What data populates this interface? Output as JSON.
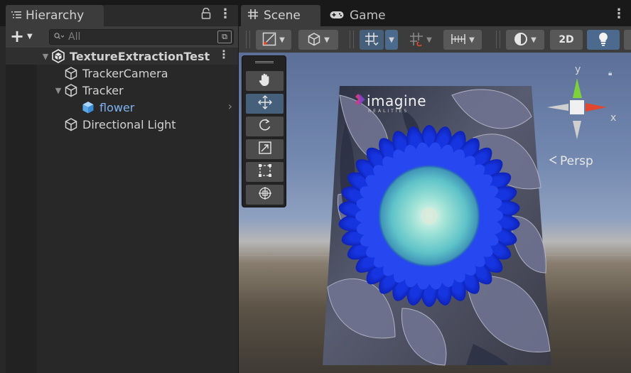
{
  "hierarchy": {
    "tab_label": "Hierarchy",
    "tab_icon": "hierarchy-list-icon",
    "search_placeholder": "All",
    "items": [
      {
        "label": "TextureExtractionTest",
        "icon": "unity-scene-icon",
        "type": "scene"
      },
      {
        "label": "TrackerCamera",
        "icon": "gameobject-cube-outline-icon"
      },
      {
        "label": "Tracker",
        "icon": "gameobject-cube-outline-icon",
        "expanded": true
      },
      {
        "label": "flower",
        "icon": "prefab-cube-blue-icon",
        "selected": true
      },
      {
        "label": "Directional Light",
        "icon": "gameobject-cube-outline-icon"
      }
    ]
  },
  "scene": {
    "tabs": [
      {
        "label": "Scene",
        "icon": "grid-hash-icon",
        "active": true
      },
      {
        "label": "Game",
        "icon": "gamepad-icon",
        "active": false
      }
    ],
    "toolbar": {
      "mode_2d_label": "2D"
    },
    "tools": [
      "hand-tool-icon",
      "move-tool-icon",
      "rotate-tool-icon",
      "scale-tool-icon",
      "rect-tool-icon",
      "transform-tool-icon"
    ],
    "active_tool": "move-tool-icon",
    "image": {
      "logo_text": "imagine",
      "logo_sub": "REALITIES"
    },
    "gizmo": {
      "y_label": "y",
      "x_label": "x",
      "projection_label": "Persp"
    },
    "colors": {
      "gizmo_y": "#7fd13b",
      "gizmo_x": "#e0472e",
      "flower_petals": "#1f37e6",
      "flower_center": "#7fd6d6",
      "selected_text": "#7fb2f0",
      "active_button": "#46607c"
    }
  }
}
